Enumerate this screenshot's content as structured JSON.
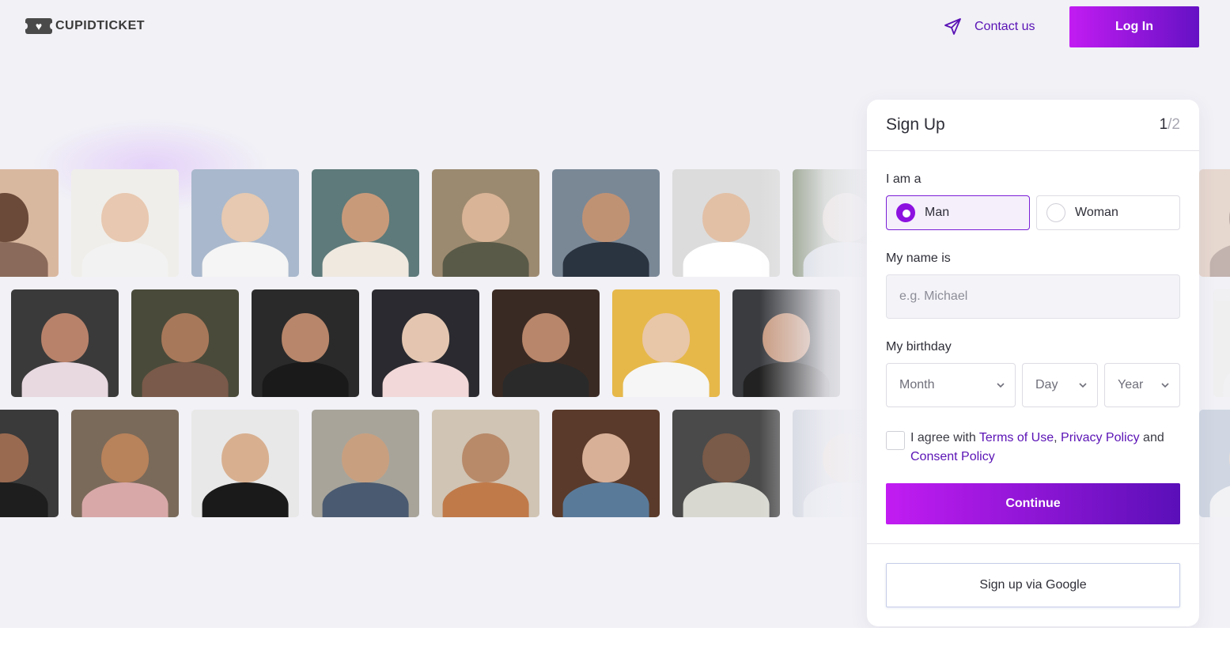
{
  "header": {
    "logo_text": "CUPIDTICKET",
    "contact_label": "Contact us",
    "login_label": "Log In"
  },
  "signup": {
    "title": "Sign Up",
    "step_current": "1",
    "step_total": "/2",
    "gender_label": "I am a",
    "gender_options": [
      "Man",
      "Woman"
    ],
    "gender_selected": "Man",
    "name_label": "My name is",
    "name_placeholder": "e.g. Michael",
    "birthday_label": "My birthday",
    "birthday_month": "Month",
    "birthday_day": "Day",
    "birthday_year": "Year",
    "agree_prefix": "I agree with ",
    "terms_link": "Terms of Use",
    "comma": ", ",
    "privacy_link": "Privacy Policy",
    "and_text": " and",
    "consent_link": "Consent Policy",
    "continue_label": "Continue",
    "google_label": "Sign up via Google"
  },
  "colors": {
    "accent_start": "#c21cf2",
    "accent_end": "#6511c4",
    "link": "#5a12b5",
    "page_bg": "#f1f1f6"
  },
  "photo_palettes": [
    [
      "#d9b8a0",
      "#6b4a3a",
      "#8a6a5a"
    ],
    [
      "#f0eeea",
      "#e8c8b0",
      "#f2f2f2"
    ],
    [
      "#a9b8cc",
      "#e6c9b0",
      "#f5f5f5"
    ],
    [
      "#5e7a7a",
      "#c99a7a",
      "#efe9e0"
    ],
    [
      "#9c8a70",
      "#d9b496",
      "#5a5a48"
    ],
    [
      "#7a8896",
      "#c09274",
      "#2a3340"
    ],
    [
      "#dcdcdc",
      "#e2c0a6",
      "#ffffff"
    ],
    [
      "#6b7a5a",
      "#d8bca4",
      "#c8d0d8"
    ],
    [
      "#3a3a3a",
      "#b8826a",
      "#e8d8e0"
    ],
    [
      "#4a4a3a",
      "#a8785a",
      "#7a5a4a"
    ],
    [
      "#2a2a2a",
      "#b8866a",
      "#1a1a1a"
    ],
    [
      "#2a2a30",
      "#e4c6b0",
      "#f2d8d8"
    ],
    [
      "#3a2a24",
      "#b8866a",
      "#2a2a2a"
    ],
    [
      "#e6b84a",
      "#e8c6a8",
      "#f6f6f6"
    ],
    [
      "#3a3c40",
      "#c89a80",
      "#222222"
    ],
    [
      "#3a3a3a",
      "#9a6a50",
      "#1e1e1e"
    ],
    [
      "#7a6a5a",
      "#b8825a",
      "#d8a8a8"
    ],
    [
      "#e8e8e8",
      "#d8b090",
      "#1a1a1a"
    ],
    [
      "#a8a49a",
      "#c8a080",
      "#4a5a70"
    ],
    [
      "#d0c4b4",
      "#b88a6a",
      "#c07a4a"
    ],
    [
      "#5a3a2a",
      "#d8b098",
      "#5a7a9a"
    ],
    [
      "#4a4a4a",
      "#7a5a48",
      "#d8d8d0"
    ],
    [
      "#c8ccd8",
      "#e8d0c0",
      "#e0e4ec"
    ]
  ]
}
